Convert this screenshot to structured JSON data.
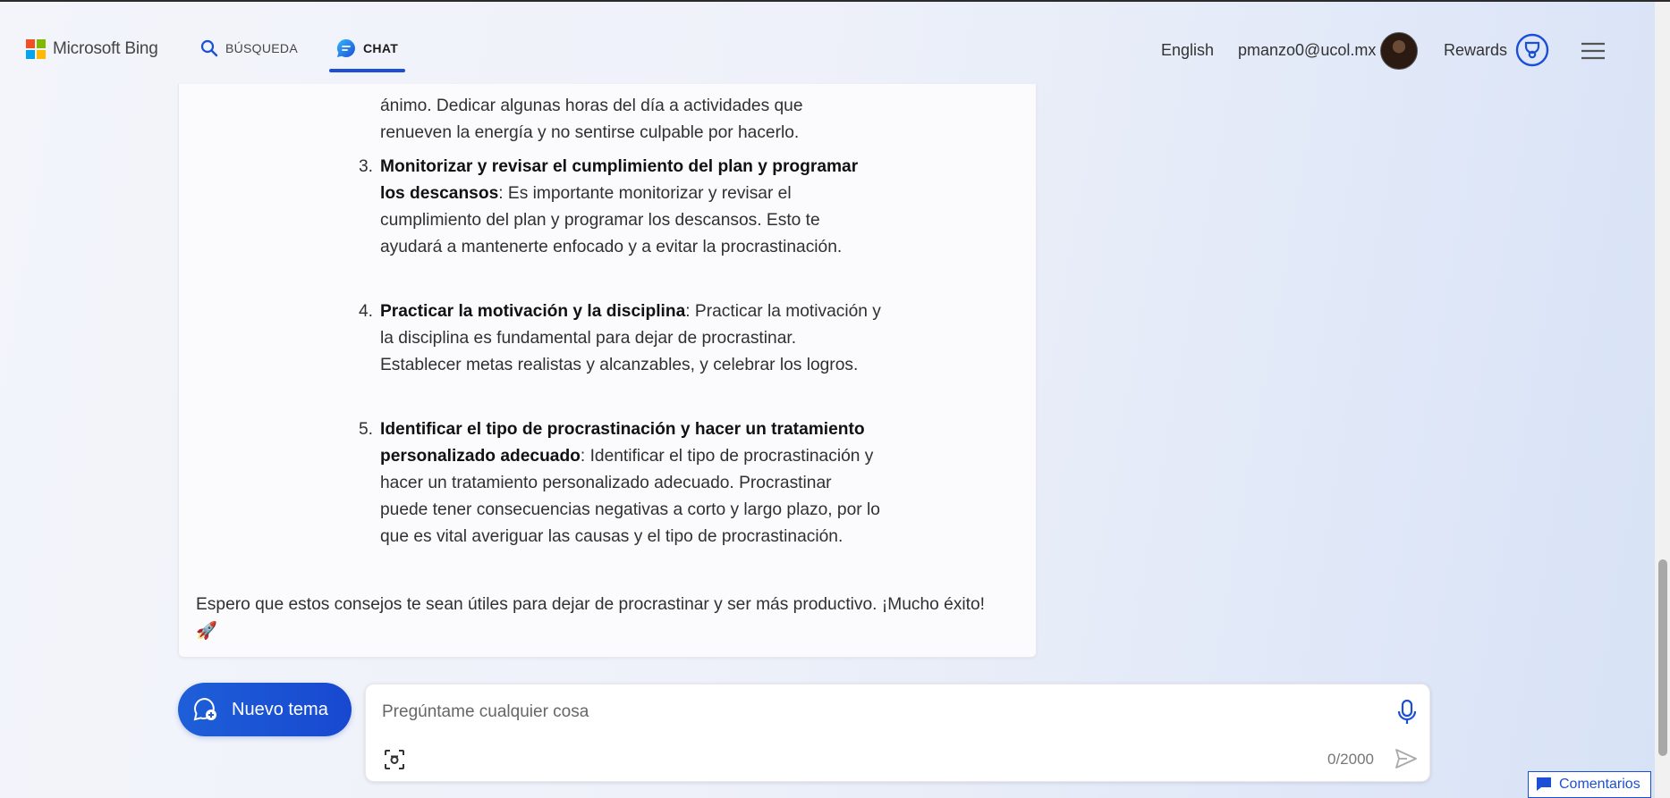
{
  "header": {
    "logo_text": "Microsoft Bing",
    "tabs": [
      {
        "label": "BÚSQUEDA",
        "icon": "search-icon"
      },
      {
        "label": "CHAT",
        "icon": "chat-bubble-icon",
        "active": true
      }
    ],
    "language": "English",
    "user_email": "pmanzo0@ucol.mx",
    "rewards_label": "Rewards"
  },
  "message": {
    "partial_text_line1": "ánimo. Dedicar algunas horas del día a actividades que",
    "partial_text_line2": "renueven la energía y no sentirse culpable por hacerlo.",
    "items": [
      {
        "number": "3.",
        "title": "Monitorizar y revisar el cumplimiento del plan y programar los descansos",
        "text": ": Es importante monitorizar y revisar el cumplimiento del plan y programar los descansos. Esto te ayudará a mantenerte enfocado y a evitar la procrastinación."
      },
      {
        "number": "4.",
        "title": "Practicar la motivación y la disciplina",
        "text": ": Practicar la motivación y la disciplina es fundamental para dejar de procrastinar. Establecer metas realistas y alcanzables, y celebrar los logros."
      },
      {
        "number": "5.",
        "title": "Identificar el tipo de procrastinación y hacer un tratamiento personalizado adecuado",
        "text": ": Identificar el tipo de procrastinación y hacer un tratamiento personalizado adecuado. Procrastinar puede tener consecuencias negativas a corto y largo plazo, por lo que es vital averiguar las causas y el tipo de procrastinación."
      }
    ],
    "closing": "Espero que estos consejos te sean útiles para dejar de procrastinar y ser más productivo. ¡Mucho éxito!",
    "closing_emoji": "🚀"
  },
  "composer": {
    "new_topic_label": "Nuevo tema",
    "placeholder": "Pregúntame cualquier cosa",
    "counter": "0/2000"
  },
  "feedback_label": "Comentarios",
  "colors": {
    "accent": "#1b4fd6",
    "new_topic_bg": "#1e5fd8"
  }
}
